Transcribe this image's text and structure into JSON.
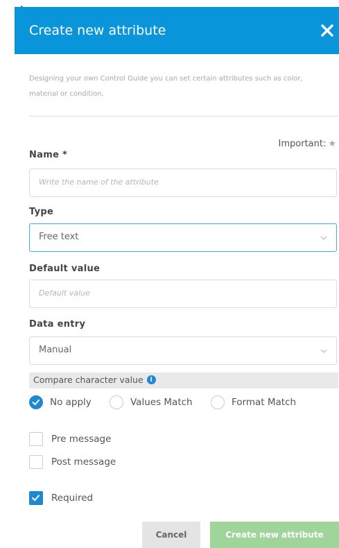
{
  "dialog": {
    "title": "Create new attribute",
    "description": "Designing your own Control Guide you can set certain attributes such as color, material or condition.",
    "important_label": "Important:",
    "colors": {
      "header": "#0a95da",
      "accent": "#1e88d0",
      "create_button": "#9fd49a"
    }
  },
  "fields": {
    "name": {
      "label": "Name *",
      "placeholder": "Write the name of the attribute",
      "value": ""
    },
    "type": {
      "label": "Type",
      "selected": "Free text"
    },
    "default_value": {
      "label": "Default value",
      "placeholder": "Default value",
      "value": ""
    },
    "data_entry": {
      "label": "Data entry",
      "selected": "Manual"
    }
  },
  "compare": {
    "label": "Compare character value",
    "options": [
      {
        "label": "No apply",
        "checked": true
      },
      {
        "label": "Values Match",
        "checked": false
      },
      {
        "label": "Format Match",
        "checked": false
      }
    ]
  },
  "checkboxes": {
    "pre_message": {
      "label": "Pre message",
      "checked": false
    },
    "post_message": {
      "label": "Post message",
      "checked": false
    },
    "required": {
      "label": "Required",
      "checked": true
    }
  },
  "buttons": {
    "cancel": "Cancel",
    "create": "Create new attribute"
  }
}
